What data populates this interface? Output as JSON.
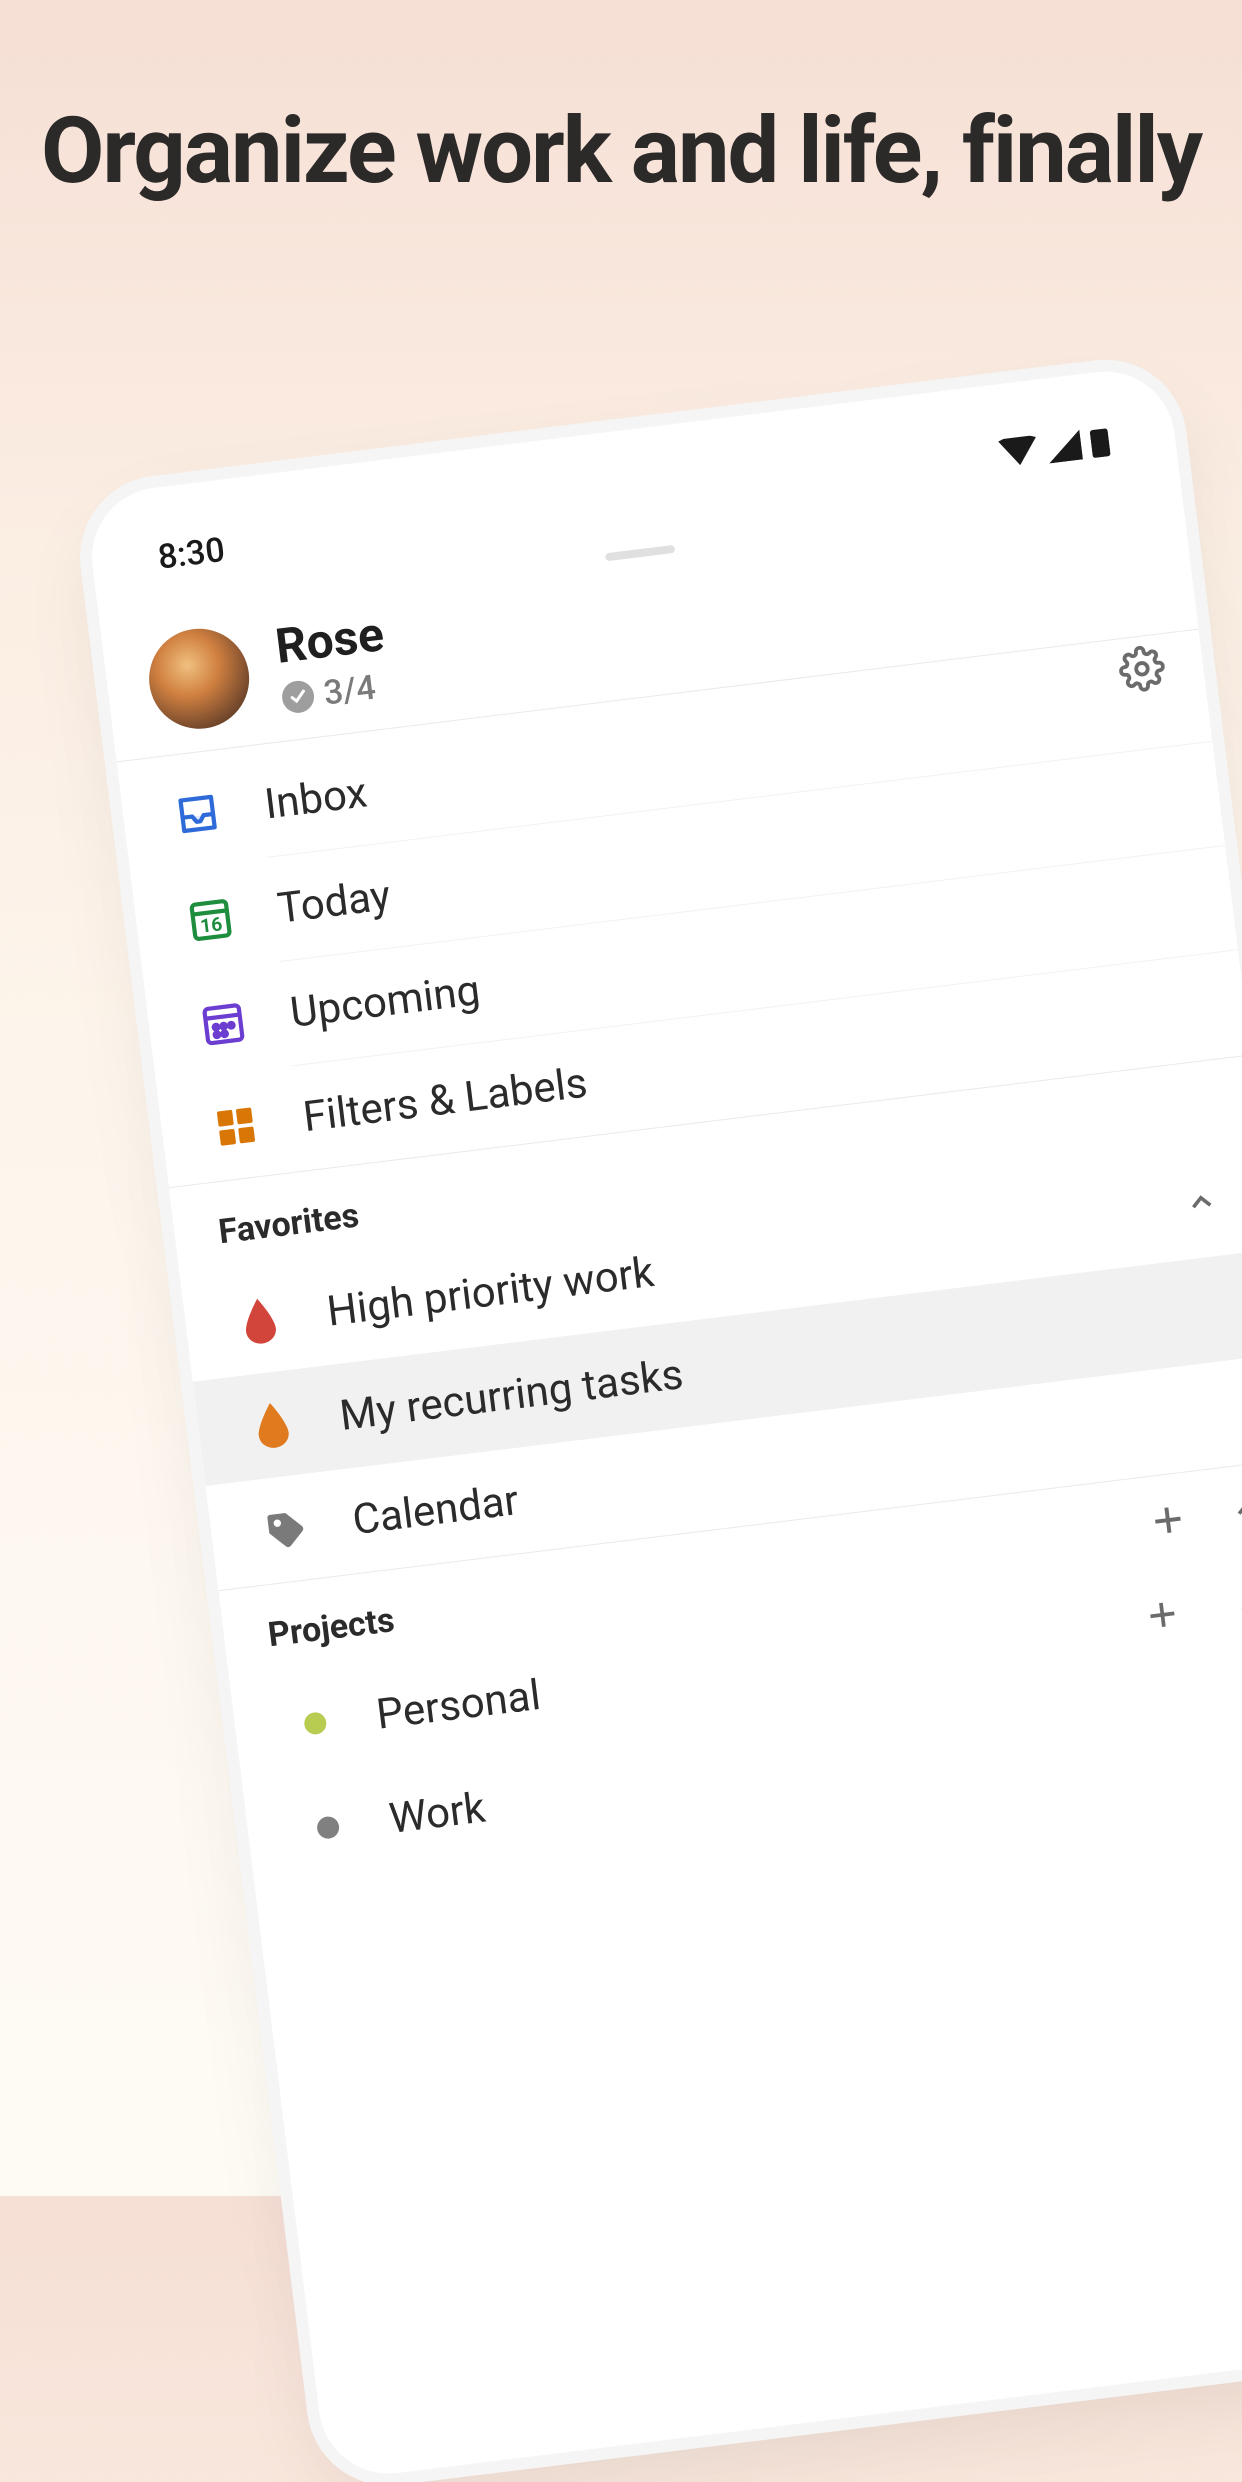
{
  "hero": {
    "title": "Organize work and life, finally"
  },
  "status": {
    "time": "8:30"
  },
  "user": {
    "name": "Rose",
    "progress": "3/4"
  },
  "nav": [
    {
      "label": "Inbox"
    },
    {
      "label": "Today",
      "day": "16"
    },
    {
      "label": "Upcoming"
    },
    {
      "label": "Filters & Labels"
    }
  ],
  "sections": {
    "favorites": {
      "title": "Favorites",
      "items": [
        {
          "label": "High priority work",
          "color": "#d1453b",
          "expanded": false
        },
        {
          "label": "My recurring tasks",
          "color": "#e07a1f",
          "selected": true
        },
        {
          "label": "Calendar",
          "iconType": "tag"
        }
      ]
    },
    "projects": {
      "title": "Projects",
      "items": [
        {
          "label": "Personal",
          "color": "#b8cc52",
          "expanded": false
        },
        {
          "label": "Work",
          "color": "#808080",
          "expanded": true
        }
      ]
    }
  }
}
